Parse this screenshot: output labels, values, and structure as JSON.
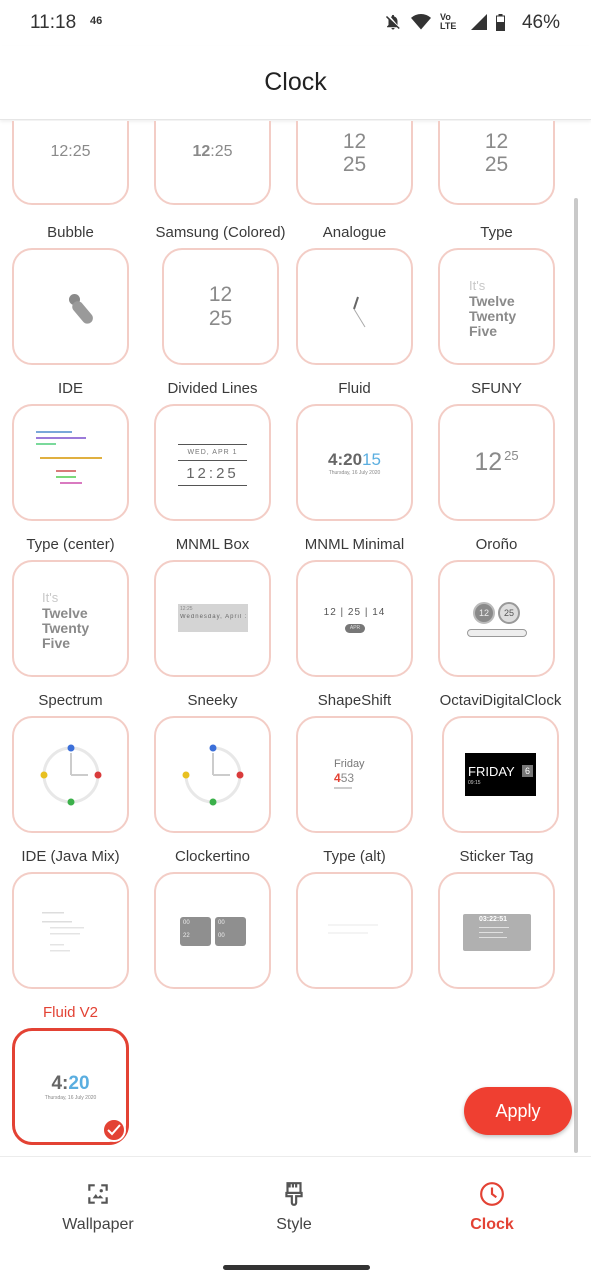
{
  "status_bar": {
    "time": "11:18",
    "network_badge": "46",
    "volte_label": "Vo LTE",
    "battery_percent": "46%"
  },
  "header": {
    "title": "Clock"
  },
  "top_partial_row": [
    {
      "preview": "12:25"
    },
    {
      "preview_bold": "12",
      "preview_rest": ":25"
    },
    {
      "line1": "12",
      "line2": "25"
    },
    {
      "line1": "12",
      "line2": "25"
    }
  ],
  "faces": [
    {
      "label": "Bubble"
    },
    {
      "label": "Samsung (Colored)",
      "line1": "12",
      "line2": "25"
    },
    {
      "label": "Analogue"
    },
    {
      "label": "Type",
      "lines": [
        "It's",
        "Twelve",
        "Twenty",
        "Five"
      ]
    },
    {
      "label": "IDE"
    },
    {
      "label": "Divided Lines",
      "top": "WED, APR 1",
      "time": "12:25"
    },
    {
      "label": "Fluid",
      "time_a": "4:20",
      "time_b": "15",
      "date": "Thursday, 16 July 2020"
    },
    {
      "label": "SFUNY",
      "hour": "12",
      "minute": "25"
    },
    {
      "label": "Type (center)",
      "lines": [
        "It's",
        "Twelve",
        "Twenty",
        "Five"
      ]
    },
    {
      "label": "MNML Box",
      "box_small": "12:25",
      "box_text": "Wednesday, April 1"
    },
    {
      "label": "MNML Minimal",
      "time": "12 | 25 | 14",
      "pill": "APR"
    },
    {
      "label": "Oroño",
      "left": "12",
      "right": "25"
    },
    {
      "label": "Spectrum"
    },
    {
      "label": "Sneeky"
    },
    {
      "label": "ShapeShift",
      "day": "Friday",
      "digit_a": "4",
      "digit_b": "53"
    },
    {
      "label": "OctaviDigitalClock",
      "day": "FRIDAY",
      "num": "6",
      "small": "09:15"
    },
    {
      "label": "IDE (Java Mix)"
    },
    {
      "label": "Clockertino",
      "cells": [
        "00",
        "22",
        "00",
        "00"
      ]
    },
    {
      "label": "Type (alt)"
    },
    {
      "label": "Sticker Tag",
      "time": "03:22:51"
    },
    {
      "label": "Fluid V2",
      "time_a": "4:",
      "time_b": "20",
      "date": "Thursday, 16 July 2020",
      "selected": true
    }
  ],
  "apply_button": "Apply",
  "bottom_nav": {
    "items": [
      {
        "label": "Wallpaper",
        "icon": "wallpaper-icon"
      },
      {
        "label": "Style",
        "icon": "brush-icon"
      },
      {
        "label": "Clock",
        "icon": "clock-icon",
        "active": true
      }
    ]
  },
  "colors": {
    "accent": "#e34234",
    "tile_border": "#f3cdc6"
  }
}
